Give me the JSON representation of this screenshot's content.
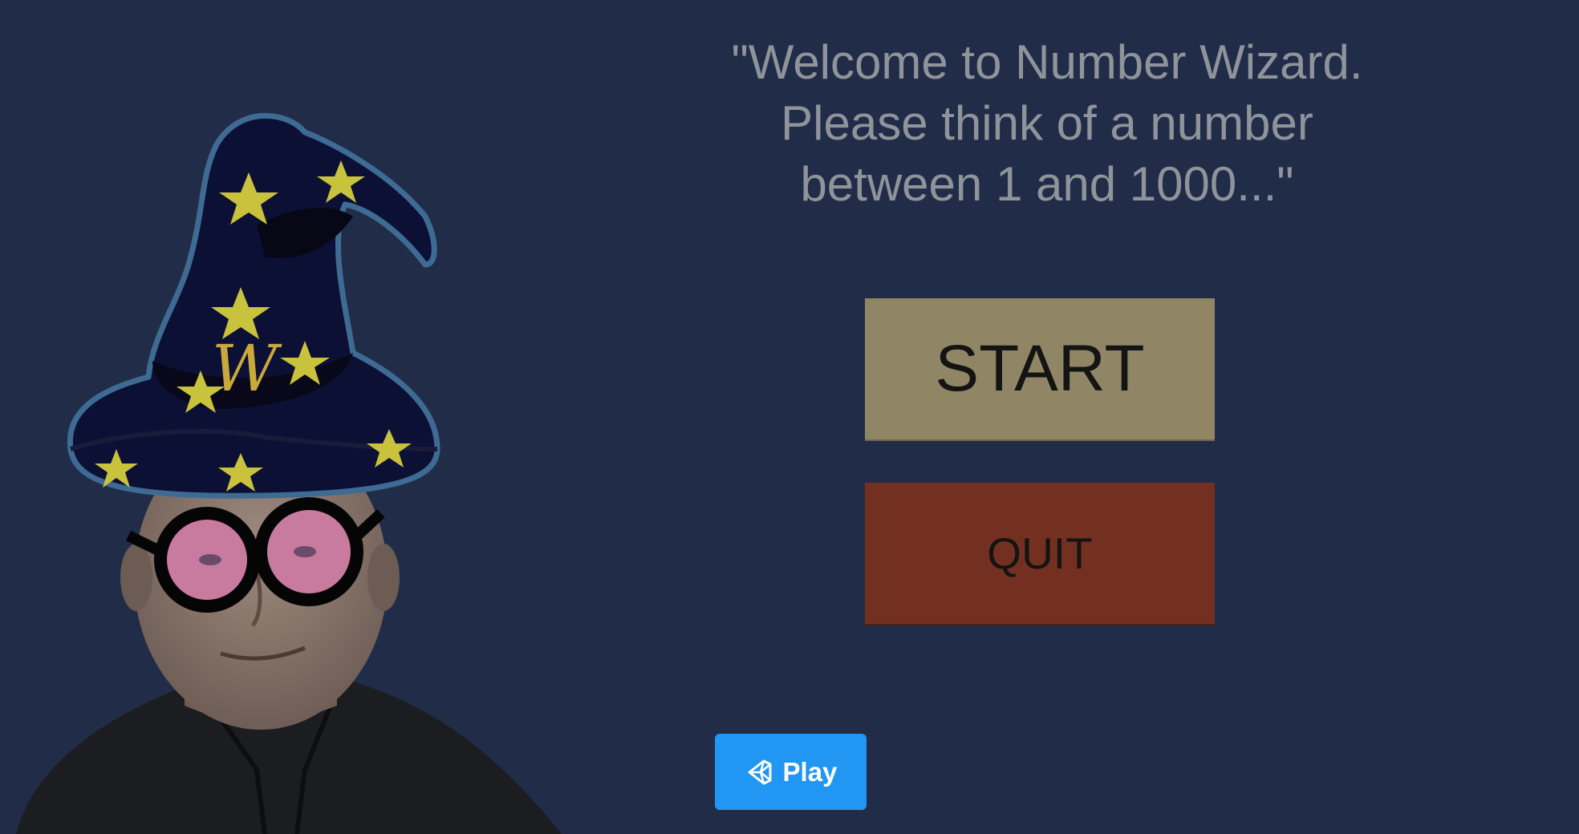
{
  "game": {
    "prompt": "\"Welcome to Number Wizard.\nPlease think of a number\nbetween 1 and 1000...\"",
    "hat_letter": "W",
    "start_label": "START",
    "quit_label": "QUIT"
  },
  "player": {
    "play_label": "Play",
    "play_icon": "unity-logo-icon"
  },
  "colors": {
    "background": "#212d48",
    "prompt_text": "#8f939a",
    "start_button": "#908665",
    "quit_button": "#733021",
    "play_button": "#2196f3",
    "hat": "#0d1035",
    "stars": "#c9c23c",
    "glasses_lens": "#c97a9f"
  }
}
